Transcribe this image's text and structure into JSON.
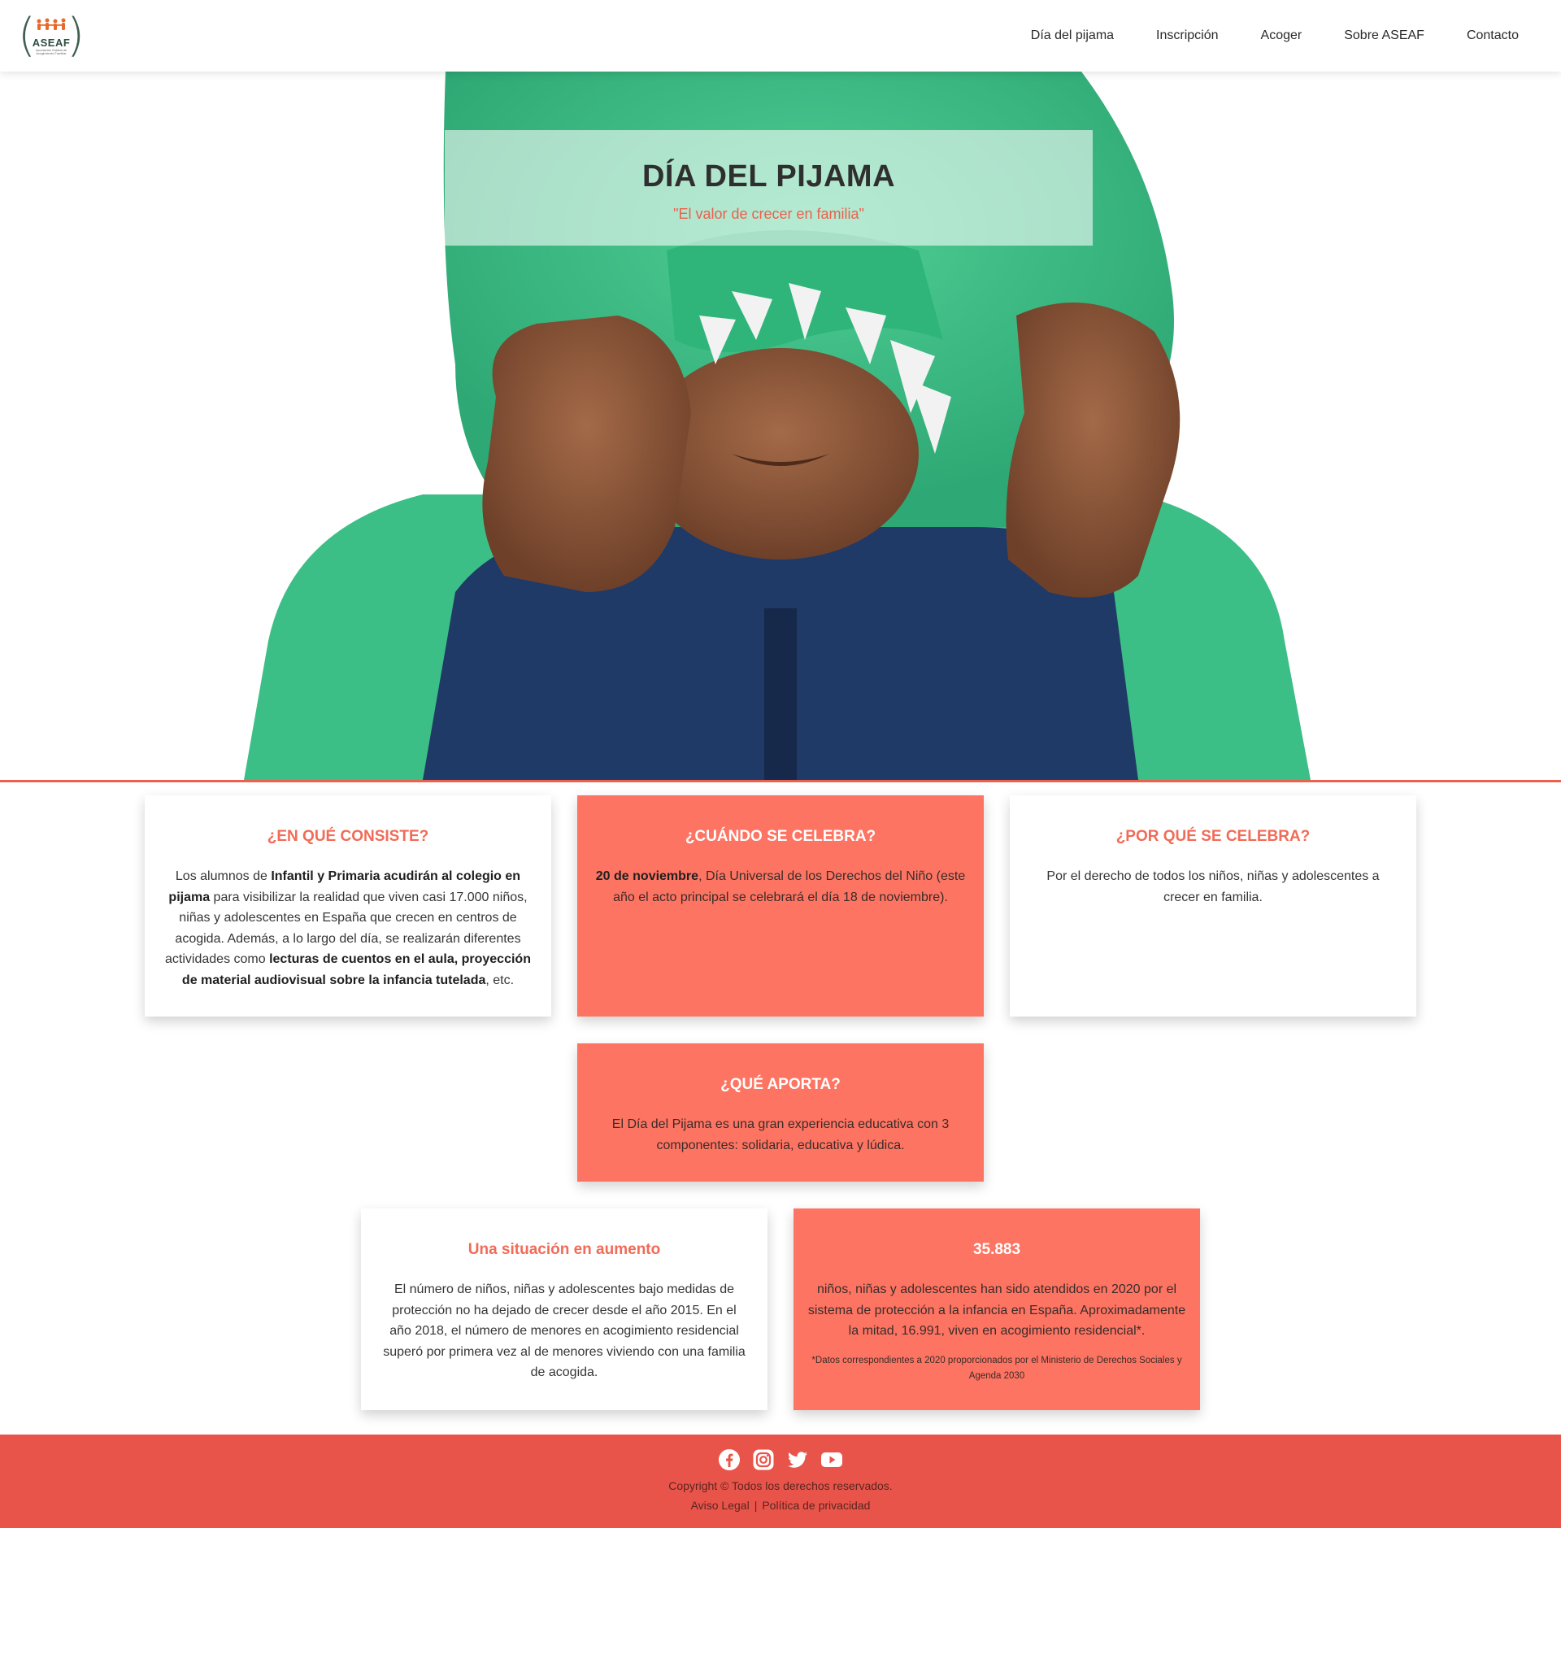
{
  "header": {
    "logo": {
      "brand": "ASEAF",
      "tagline": "Asociación Estatal de Acogimiento Familiar",
      "icon": "aseaf-family-logo"
    },
    "nav": [
      "Día del pijama",
      "Inscripción",
      "Acoger",
      "Sobre ASEAF",
      "Contacto"
    ]
  },
  "hero": {
    "title": "DÍA DEL PIJAMA",
    "subtitle": "\"El valor de crecer en familia\"",
    "image": "child-in-green-dinosaur-hood-photo"
  },
  "cards": {
    "consiste": {
      "title": "¿EN QUÉ CONSISTE?",
      "t1": "Los alumnos de ",
      "b1": "Infantil y Primaria acudirán al colegio en pijama",
      "t2": " para visibilizar la realidad que viven casi 17.000 niños, niñas y adolescentes en España que crecen en centros de acogida. Además, a lo largo del día, se realizarán diferentes actividades como ",
      "b2": "lecturas de cuentos en el aula, proyección de material audiovisual sobre la infancia tutelada",
      "t3": ", etc."
    },
    "cuando": {
      "title": "¿CUÁNDO SE CELEBRA?",
      "b1": "20 de noviembre",
      "t1": ", Día Universal de los Derechos del Niño (este año el acto principal se celebrará el día 18 de noviembre)."
    },
    "porque": {
      "title": "¿POR QUÉ SE CELEBRA?",
      "text": "Por el derecho de todos los niños, niñas y adolescentes a crecer en familia."
    },
    "aporta": {
      "title": "¿QUÉ APORTA?",
      "text": "El Día del Pijama es una gran experiencia educativa con 3 componentes: solidaria, educativa y lúdica."
    },
    "situacion": {
      "title": "Una situación en aumento",
      "text": "El número de niños, niñas y adolescentes bajo medidas de protección no ha dejado de crecer desde el año 2015. En el año 2018, el número de menores en acogimiento residencial superó por primera vez al de menores viviendo con una familia de acogida."
    },
    "cifra": {
      "title": "35.883",
      "text": "niños, niñas y adolescentes han sido atendidos en 2020 por el sistema de protección a la infancia en España. Aproximadamente la mitad, 16.991, viven en acogimiento residencial*.",
      "note": "*Datos correspondientes a 2020 proporcionados por el Ministerio de Derechos Sociales y Agenda 2030"
    }
  },
  "footer": {
    "socials": [
      "facebook-icon",
      "instagram-icon",
      "twitter-icon",
      "youtube-icon"
    ],
    "copyright": "Copyright © Todos los derechos reservados.",
    "legal": [
      "Aviso Legal",
      "Política de privacidad"
    ],
    "separator": "|"
  },
  "colors": {
    "accent": "#fd7462",
    "accent_text": "#f16b57",
    "footer": "#e9544a",
    "hero_line": "#e9614f"
  }
}
